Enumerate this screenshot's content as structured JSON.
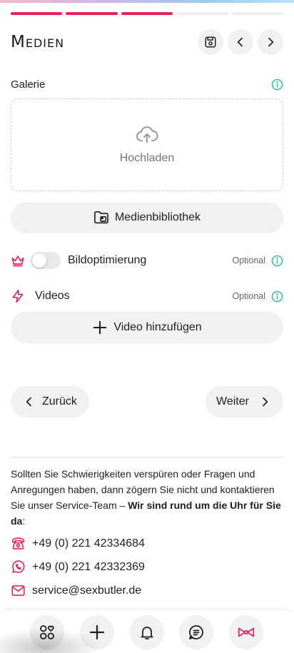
{
  "colors": {
    "accent": "#e2245a",
    "progress_done": "#e2245a",
    "progress_todo": "#eeeeee",
    "info_green": "#1fc08e",
    "pill_bg": "#f0f1f0"
  },
  "progress": {
    "total_steps": 5,
    "completed_steps": 3
  },
  "header": {
    "title": "Medien",
    "icons": [
      "save-icon",
      "chevron-left-icon",
      "chevron-right-icon"
    ]
  },
  "gallery": {
    "label": "Galerie",
    "upload_label": "Hochladen"
  },
  "media_library": {
    "label": "Medienbibliothek"
  },
  "image_optimization": {
    "label": "Bildoptimierung",
    "optional": "Optional",
    "enabled": false
  },
  "videos": {
    "label": "Videos",
    "optional": "Optional",
    "add_label": "Video hinzufügen"
  },
  "navigation": {
    "back_label": "Zurück",
    "next_label": "Weiter"
  },
  "info": {
    "text": "Sollten Sie Schwierigkeiten verspüren oder Fragen und Anregungen haben, dann zögern Sie nicht und kontaktieren Sie unser Service-Team – ",
    "bold": "Wir sind rund um die Uhr für Sie da",
    "suffix": ":"
  },
  "contacts": {
    "phone": "+49 (0) 221 42334684",
    "whatsapp": "+49 (0) 221 42332369",
    "email": "service@sexbutler.de"
  },
  "bottom_nav": [
    "apps-heart-icon",
    "plus-icon",
    "bell-icon",
    "chat-icon",
    "bow-icon"
  ]
}
